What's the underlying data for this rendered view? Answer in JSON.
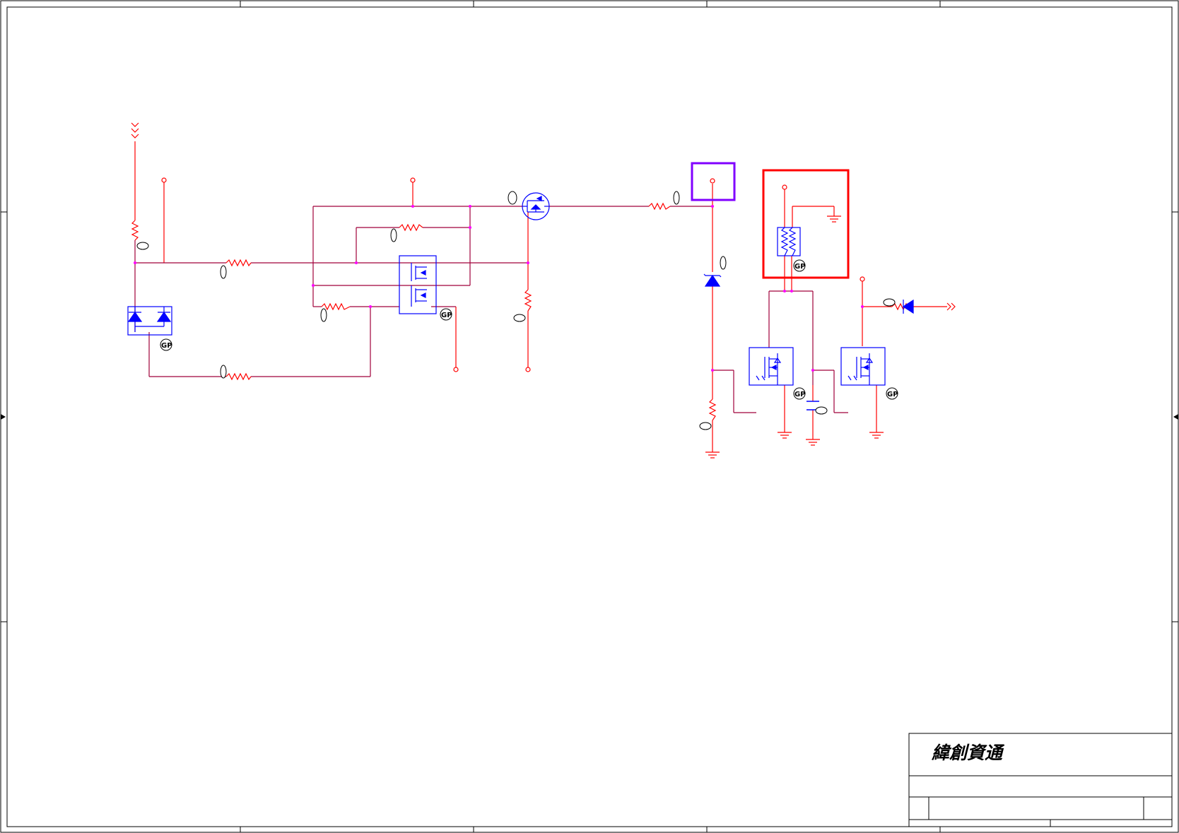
{
  "title_block": {
    "company_name": "緯創資通"
  },
  "badges": {
    "gp_label": "GP"
  },
  "colors": {
    "wire_red": "#ff0000",
    "wire_maroon": "#a0003a",
    "component_blue": "#0000ff",
    "junction_magenta": "#ff00ff",
    "highlight_red": "#ff0000",
    "highlight_purple": "#8000ff",
    "frame_black": "#000000"
  }
}
